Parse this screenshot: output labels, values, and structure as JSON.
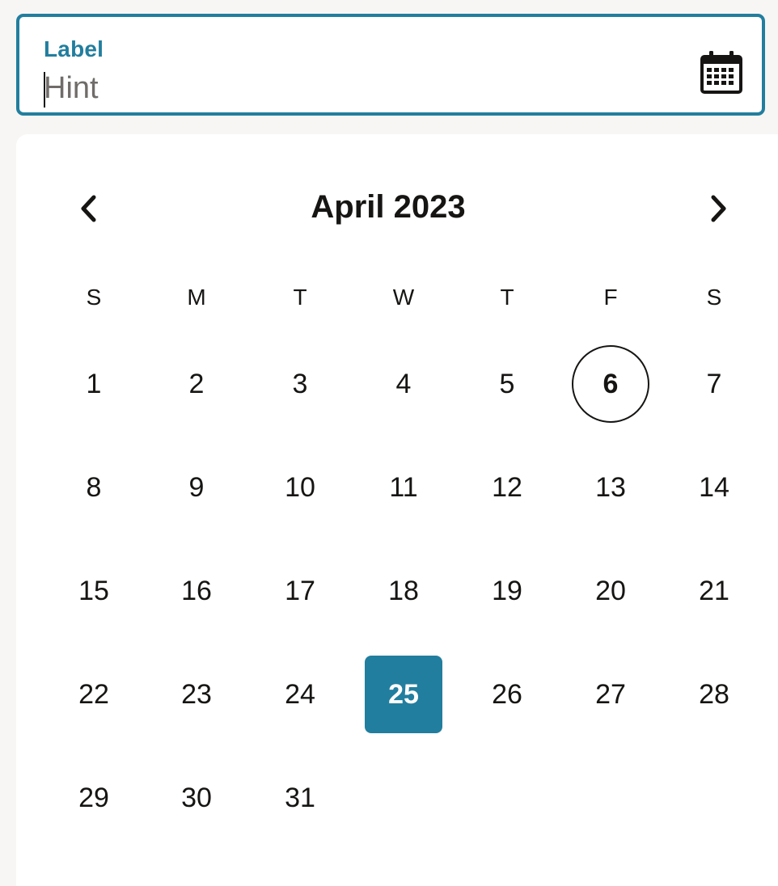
{
  "field": {
    "label": "Label",
    "placeholder": "Hint",
    "value": "",
    "icon": "calendar-icon"
  },
  "calendar": {
    "month_title": "April 2023",
    "prev_icon": "chevron-left-icon",
    "next_icon": "chevron-right-icon",
    "weekdays": [
      "S",
      "M",
      "T",
      "W",
      "T",
      "F",
      "S"
    ],
    "weeks": [
      [
        "",
        "",
        "",
        "",
        "",
        "",
        ""
      ],
      [
        "1",
        "2",
        "3",
        "4",
        "5",
        "6",
        "7"
      ],
      [
        "8",
        "9",
        "10",
        "11",
        "12",
        "13",
        "14"
      ],
      [
        "15",
        "16",
        "17",
        "18",
        "19",
        "20",
        "21"
      ],
      [
        "22",
        "23",
        "24",
        "25",
        "26",
        "27",
        "28"
      ],
      [
        "29",
        "30",
        "31",
        "",
        "",
        "",
        ""
      ]
    ],
    "today": "6",
    "selected": "25"
  },
  "colors": {
    "accent": "#227e9e",
    "text": "#161513",
    "hint": "#6f6c69",
    "background": "#f7f6f4",
    "panel": "#ffffff"
  }
}
